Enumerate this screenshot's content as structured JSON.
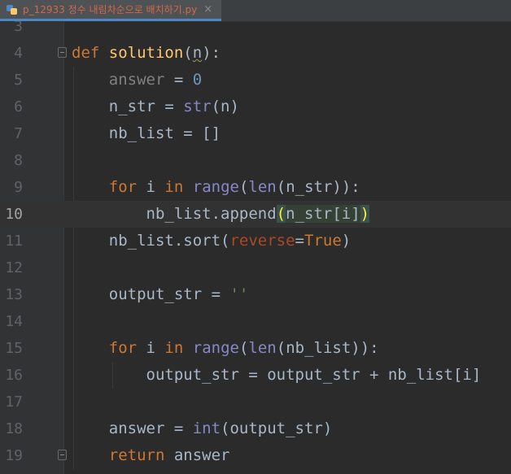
{
  "tab": {
    "filename": "p_12933 정수 내림차순으로 배치하기.py",
    "close_glyph": "×",
    "icon": "python-file-icon"
  },
  "editor": {
    "current_line": 10,
    "lines": [
      {
        "n": "3",
        "tokens": []
      },
      {
        "n": "4",
        "tokens": [
          [
            "kw",
            "def"
          ],
          [
            "t",
            " "
          ],
          [
            "fn",
            "solution"
          ],
          [
            "t",
            "("
          ],
          [
            "warn",
            "n"
          ],
          [
            "t",
            "):"
          ]
        ]
      },
      {
        "n": "5",
        "tokens": [
          [
            "t",
            "    "
          ],
          [
            "gray",
            "answer"
          ],
          [
            "t",
            " = "
          ],
          [
            "num",
            "0"
          ]
        ]
      },
      {
        "n": "6",
        "tokens": [
          [
            "t",
            "    n_str = "
          ],
          [
            "bi",
            "str"
          ],
          [
            "t",
            "(n)"
          ]
        ]
      },
      {
        "n": "7",
        "tokens": [
          [
            "t",
            "    nb_list = []"
          ]
        ]
      },
      {
        "n": "8",
        "tokens": []
      },
      {
        "n": "9",
        "tokens": [
          [
            "t",
            "    "
          ],
          [
            "kw",
            "for"
          ],
          [
            "t",
            " i "
          ],
          [
            "kw",
            "in"
          ],
          [
            "t",
            " "
          ],
          [
            "bi",
            "range"
          ],
          [
            "t",
            "("
          ],
          [
            "bi",
            "len"
          ],
          [
            "t",
            "(n_str)):"
          ]
        ]
      },
      {
        "n": "10",
        "tokens": [
          [
            "t",
            "        nb_list.append"
          ],
          [
            "bq",
            "("
          ],
          [
            "hl",
            "n_str[i]"
          ],
          [
            "bq",
            ")"
          ]
        ]
      },
      {
        "n": "11",
        "tokens": [
          [
            "t",
            "    nb_list.sort("
          ],
          [
            "param",
            "reverse"
          ],
          [
            "t",
            "="
          ],
          [
            "kw",
            "True"
          ],
          [
            "t",
            ")"
          ]
        ]
      },
      {
        "n": "12",
        "tokens": []
      },
      {
        "n": "13",
        "tokens": [
          [
            "t",
            "    output_str = "
          ],
          [
            "str",
            "''"
          ]
        ]
      },
      {
        "n": "14",
        "tokens": []
      },
      {
        "n": "15",
        "tokens": [
          [
            "t",
            "    "
          ],
          [
            "kw",
            "for"
          ],
          [
            "t",
            " i "
          ],
          [
            "kw",
            "in"
          ],
          [
            "t",
            " "
          ],
          [
            "bi",
            "range"
          ],
          [
            "t",
            "("
          ],
          [
            "bi",
            "len"
          ],
          [
            "t",
            "(nb_list)):"
          ]
        ]
      },
      {
        "n": "16",
        "tokens": [
          [
            "t",
            "        output_str = output_str + nb_list[i]"
          ]
        ]
      },
      {
        "n": "17",
        "tokens": []
      },
      {
        "n": "18",
        "tokens": [
          [
            "t",
            "    answer = "
          ],
          [
            "bi",
            "int"
          ],
          [
            "t",
            "(output_str)"
          ]
        ]
      },
      {
        "n": "19",
        "tokens": [
          [
            "t",
            "    "
          ],
          [
            "kw",
            "return"
          ],
          [
            "t",
            " answer"
          ]
        ]
      }
    ]
  }
}
